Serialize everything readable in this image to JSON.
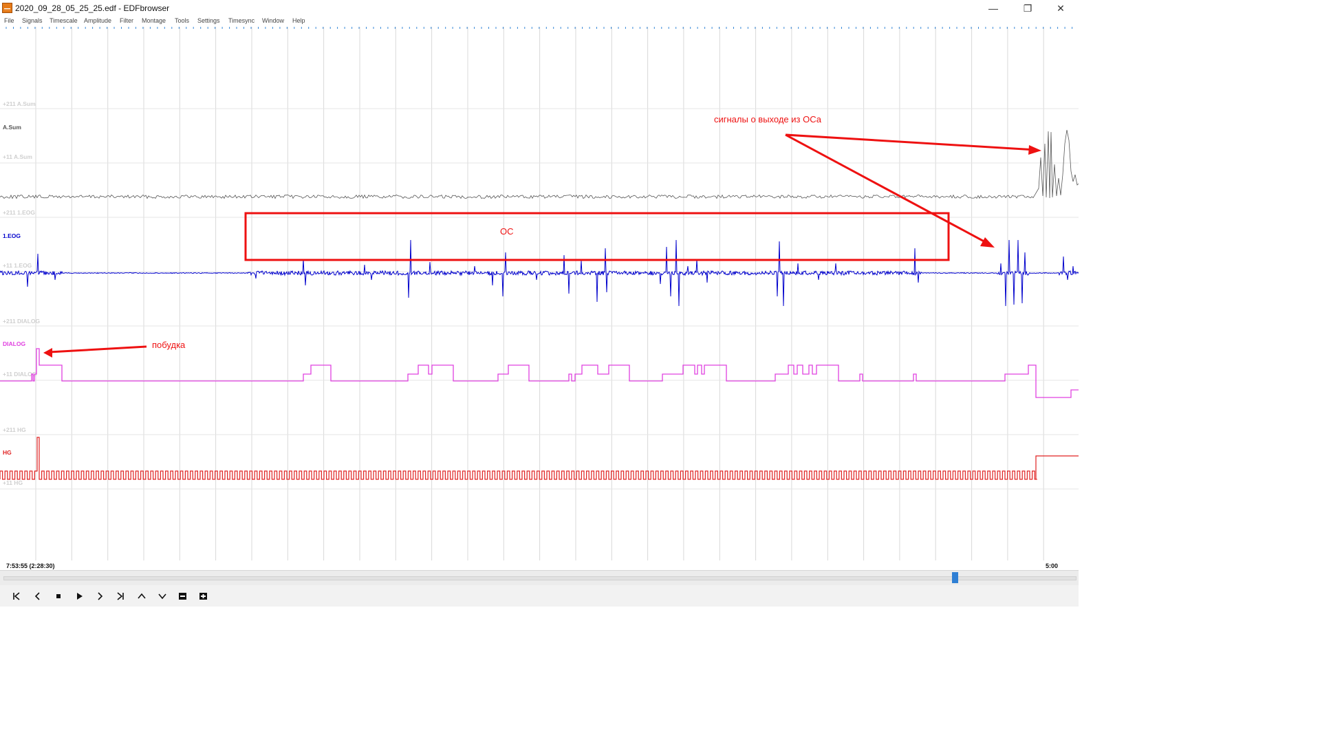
{
  "window": {
    "title": "2020_09_28_05_25_25.edf - EDFbrowser",
    "controls": {
      "minimize": "—",
      "restore": "❐",
      "close": "✕"
    }
  },
  "menu": [
    "File",
    "Signals",
    "Timescale",
    "Amplitude",
    "Filter",
    "Montage",
    "Tools",
    "Settings",
    "Timesync",
    "Window",
    "Help"
  ],
  "signals": {
    "asum": {
      "label": "A.Sum",
      "upper": "+211 A.Sum",
      "lower": "+11 A.Sum",
      "color": "#555555"
    },
    "eog": {
      "label": "1.EOG",
      "upper": "+211 1.EOG",
      "lower": "+11 1.EOG",
      "color": "#0000cc"
    },
    "dialog": {
      "label": "DIALOG",
      "upper": "+211 DIALOG",
      "lower": "+11 DIALOG",
      "color": "#e040e0"
    },
    "hg": {
      "label": "HG",
      "upper": "+211 HG",
      "lower": "+11 HG",
      "color": "#e02020"
    }
  },
  "annotations": {
    "color": "#ee1111",
    "exit_signals": "сигналы о выходе из ОСа",
    "os_box": "ОС",
    "wakeup": "побудка"
  },
  "time": {
    "start": "7:53:55 (2:28:30)",
    "end": "5:00"
  },
  "scrollbar": {
    "position": 0.885
  },
  "toolbar": {
    "first": "first-page",
    "prev": "previous-page",
    "stop": "stop",
    "play": "play",
    "next": "next-page",
    "last": "last-page",
    "up": "shift-up",
    "down": "shift-down",
    "zoom_out": "zoom-out",
    "zoom_in": "zoom-in"
  }
}
